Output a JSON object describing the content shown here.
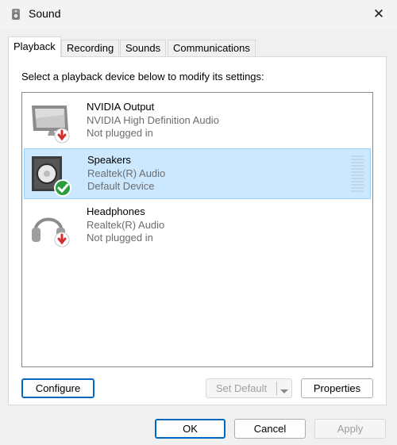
{
  "window": {
    "title": "Sound",
    "close_glyph": "✕",
    "icon": "speaker-icon"
  },
  "tabs": [
    {
      "label": "Playback",
      "active": true
    },
    {
      "label": "Recording",
      "active": false
    },
    {
      "label": "Sounds",
      "active": false
    },
    {
      "label": "Communications",
      "active": false
    }
  ],
  "playback": {
    "instruction": "Select a playback device below to modify its settings:",
    "devices": [
      {
        "name": "NVIDIA Output",
        "driver": "NVIDIA High Definition Audio",
        "status": "Not plugged in",
        "icon": "monitor-icon",
        "badge": "unplugged-badge",
        "selected": false
      },
      {
        "name": "Speakers",
        "driver": "Realtek(R) Audio",
        "status": "Default Device",
        "icon": "speaker-icon",
        "badge": "default-check-badge",
        "selected": true
      },
      {
        "name": "Headphones",
        "driver": "Realtek(R) Audio",
        "status": "Not plugged in",
        "icon": "headphones-icon",
        "badge": "unplugged-badge",
        "selected": false
      }
    ]
  },
  "buttons": {
    "configure": "Configure",
    "set_default": "Set Default",
    "properties": "Properties",
    "ok": "OK",
    "cancel": "Cancel",
    "apply": "Apply"
  },
  "colors": {
    "selection_bg": "#cce8ff",
    "selection_border": "#99d1ff",
    "accent": "#0067c0",
    "check_green": "#2a9d3c",
    "unplug_red": "#d32f2f"
  }
}
